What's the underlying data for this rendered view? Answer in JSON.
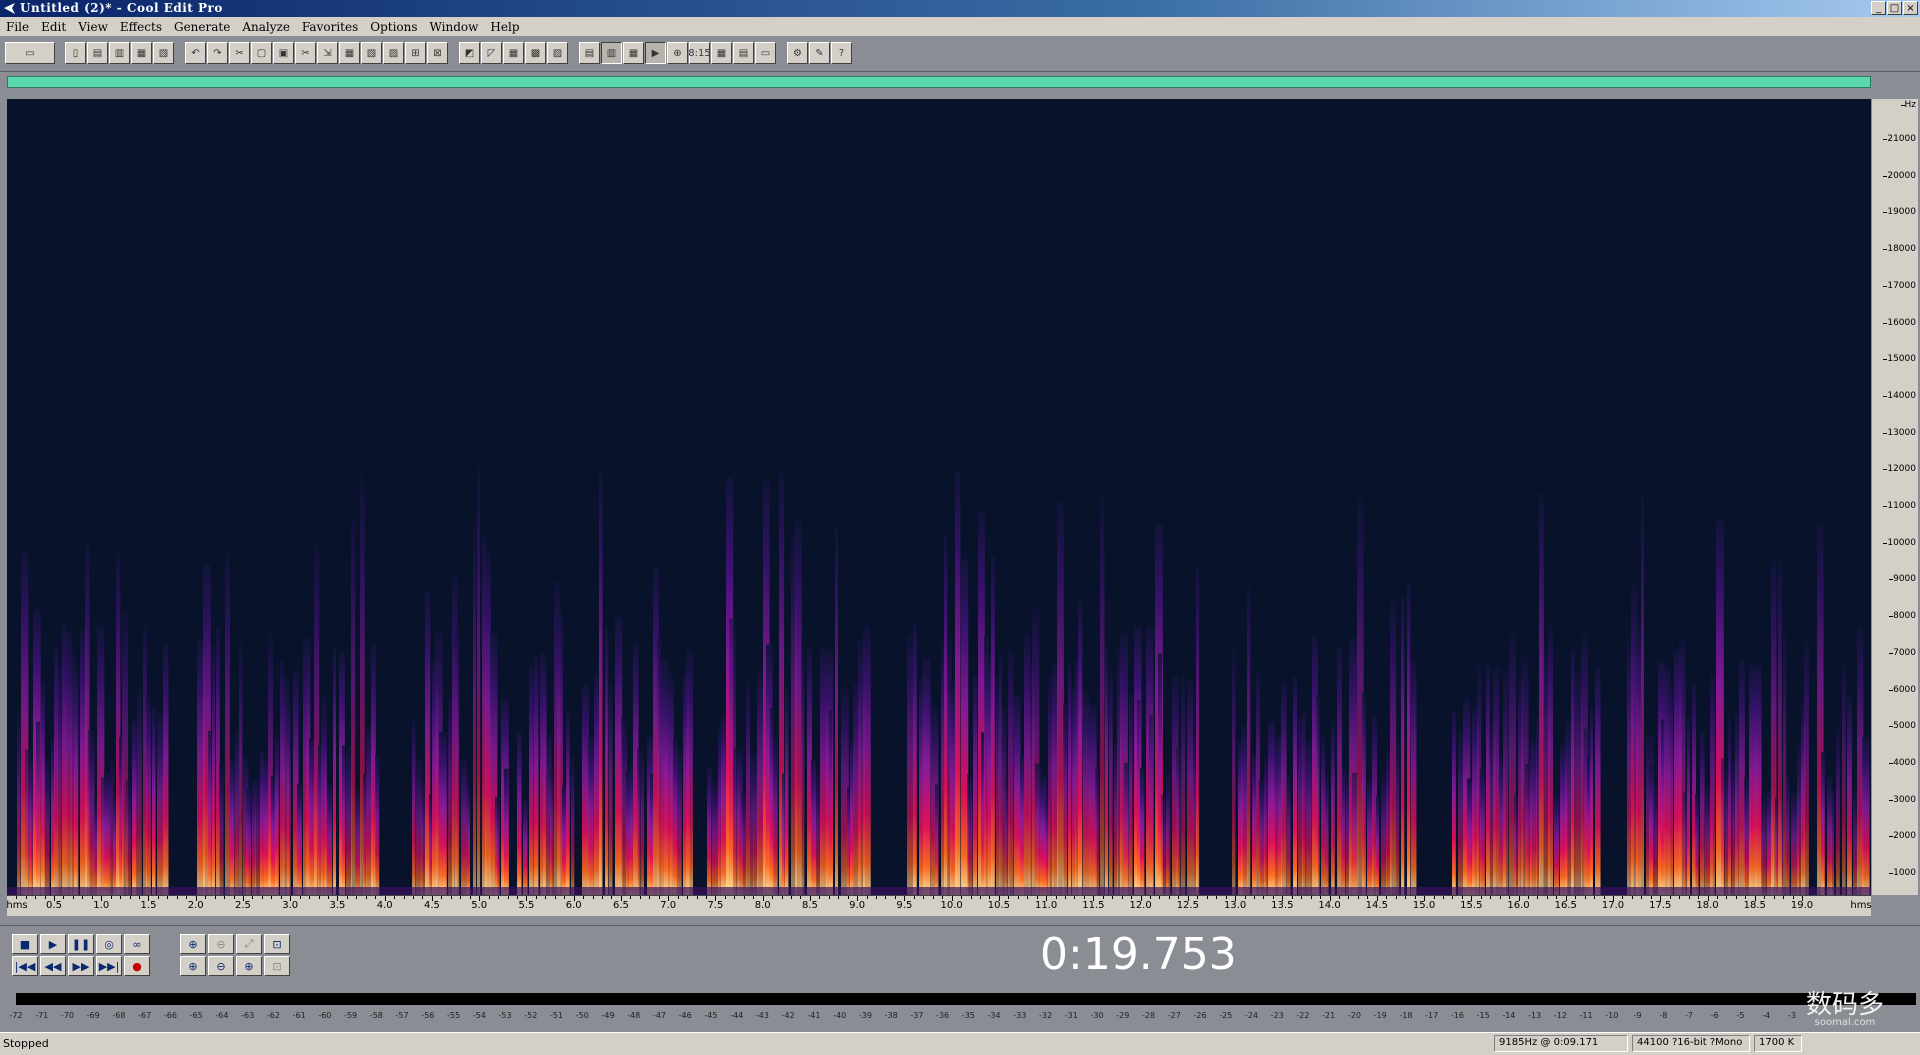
{
  "window": {
    "title": "Untitled (2)* - Cool Edit Pro",
    "controls": [
      "_",
      "□",
      "×"
    ]
  },
  "menu": [
    "File",
    "Edit",
    "View",
    "Effects",
    "Generate",
    "Analyze",
    "Favorites",
    "Options",
    "Window",
    "Help"
  ],
  "toolbar": {
    "groups": [
      [
        "waveform-multitrack-toggle-icon"
      ],
      [
        "new-file-icon",
        "open-file-icon",
        "save-icon",
        "save-all-icon",
        "close-icon"
      ],
      [
        "undo-icon",
        "redo-icon",
        "repeat-icon",
        "copy-new-icon",
        "copy-icon",
        "cut-icon",
        "mix-paste-icon",
        "paste-icon",
        "clipboard-1-icon",
        "clipboard-2-icon",
        "trim-icon",
        "find-beats-icon"
      ],
      [
        "amplify-icon",
        "envelope-icon",
        "normalize-icon",
        "noise-reduction-icon",
        "graphic-eq-icon"
      ],
      [
        "waveform-view-icon",
        "spectral-view-icon",
        "spectral-pan-icon",
        "play-view-icon",
        "zoom-view-icon",
        "time-icon",
        "cue-list-icon",
        "bar-meter-icon",
        "marker-icon"
      ],
      [
        "settings-icon",
        "script-icon",
        "help-icon"
      ]
    ]
  },
  "spectrogram": {
    "freq_unit": "Hz",
    "freq_labels": [
      "21000",
      "20000",
      "19000",
      "18000",
      "17000",
      "16000",
      "15000",
      "14000",
      "13000",
      "12000",
      "11000",
      "10000",
      "9000",
      "8000",
      "7000",
      "6000",
      "5000",
      "4000",
      "3000",
      "2000",
      "1000"
    ],
    "time_unit": "hms",
    "time_labels": [
      "0.5",
      "1.0",
      "1.5",
      "2.0",
      "2.5",
      "3.0",
      "3.5",
      "4.0",
      "4.5",
      "5.0",
      "5.5",
      "6.0",
      "6.5",
      "7.0",
      "7.5",
      "8.0",
      "8.5",
      "9.0",
      "9.5",
      "10.0",
      "10.5",
      "11.0",
      "11.5",
      "12.0",
      "12.5",
      "13.0",
      "13.5",
      "14.0",
      "14.5",
      "15.0",
      "15.5",
      "16.0",
      "16.5",
      "17.0",
      "17.5",
      "18.0",
      "18.5",
      "19.0"
    ]
  },
  "transport": {
    "row1": [
      "■",
      "▶",
      "❚❚",
      "◎",
      "∞"
    ],
    "row2": [
      "|◀◀",
      "◀◀",
      "▶▶",
      "▶▶|",
      "●"
    ],
    "zoom_row1": [
      "⊕",
      "⊖",
      "⤢",
      "⊡"
    ],
    "zoom_row2": [
      "⊕",
      "⊖",
      "⊕",
      "⊡"
    ]
  },
  "time_display": "0:19.753",
  "meter": {
    "labels": [
      "-72",
      "-71",
      "-70",
      "-69",
      "-68",
      "-67",
      "-66",
      "-65",
      "-64",
      "-63",
      "-62",
      "-61",
      "-60",
      "-59",
      "-58",
      "-57",
      "-56",
      "-55",
      "-54",
      "-53",
      "-52",
      "-51",
      "-50",
      "-49",
      "-48",
      "-47",
      "-46",
      "-45",
      "-44",
      "-43",
      "-42",
      "-41",
      "-40",
      "-39",
      "-38",
      "-37",
      "-36",
      "-35",
      "-34",
      "-33",
      "-32",
      "-31",
      "-30",
      "-29",
      "-28",
      "-27",
      "-26",
      "-25",
      "-24",
      "-23",
      "-22",
      "-21",
      "-20",
      "-19",
      "-18",
      "-17",
      "-16",
      "-15",
      "-14",
      "-13",
      "-12",
      "-11",
      "-10",
      "-9",
      "-8",
      "-7",
      "-6",
      "-5",
      "-4",
      "-3"
    ]
  },
  "status": {
    "state": "Stopped",
    "cursor": "9185Hz @  0:09.171",
    "format": "44100 ?16-bit ?Mono",
    "size": "1700 K"
  },
  "watermark": {
    "text": "数码多",
    "sub": "soomal.com"
  }
}
